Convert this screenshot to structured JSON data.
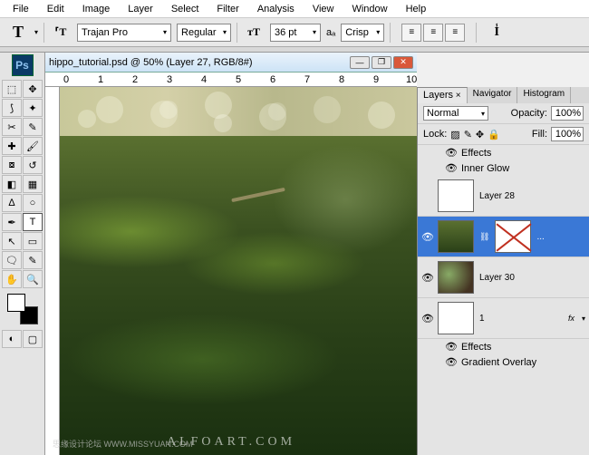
{
  "menubar": [
    "File",
    "Edit",
    "Image",
    "Layer",
    "Select",
    "Filter",
    "Analysis",
    "View",
    "Window",
    "Help"
  ],
  "optbar": {
    "font_family": "Trajan Pro",
    "font_style": "Regular",
    "font_size": "36 pt",
    "aa_label": "Crisp",
    "aa_prefix": "aₐ"
  },
  "doc": {
    "title": "hippo_tutorial.psd @ 50% (Layer 27, RGB/8#)",
    "ruler_marks": [
      "0",
      "1",
      "2",
      "3",
      "4",
      "5",
      "6",
      "7",
      "8",
      "9",
      "10"
    ]
  },
  "watermark_main": "ALFOART.COM",
  "watermark_sub": "思缘设计论坛 WWW.MISSYUAN.COM",
  "panels": {
    "tabs": [
      "Layers",
      "Navigator",
      "Histogram"
    ],
    "blend_mode": "Normal",
    "opacity_label": "Opacity:",
    "opacity_value": "100%",
    "lock_label": "Lock:",
    "fill_label": "Fill:",
    "fill_value": "100%",
    "effects_label": "Effects",
    "inner_glow": "Inner Glow",
    "gradient_overlay": "Gradient Overlay",
    "layers": [
      {
        "name": "Layer 28"
      },
      {
        "name": "..."
      },
      {
        "name": "Layer 30"
      },
      {
        "name": "1"
      }
    ],
    "fx_badge": "fx"
  }
}
